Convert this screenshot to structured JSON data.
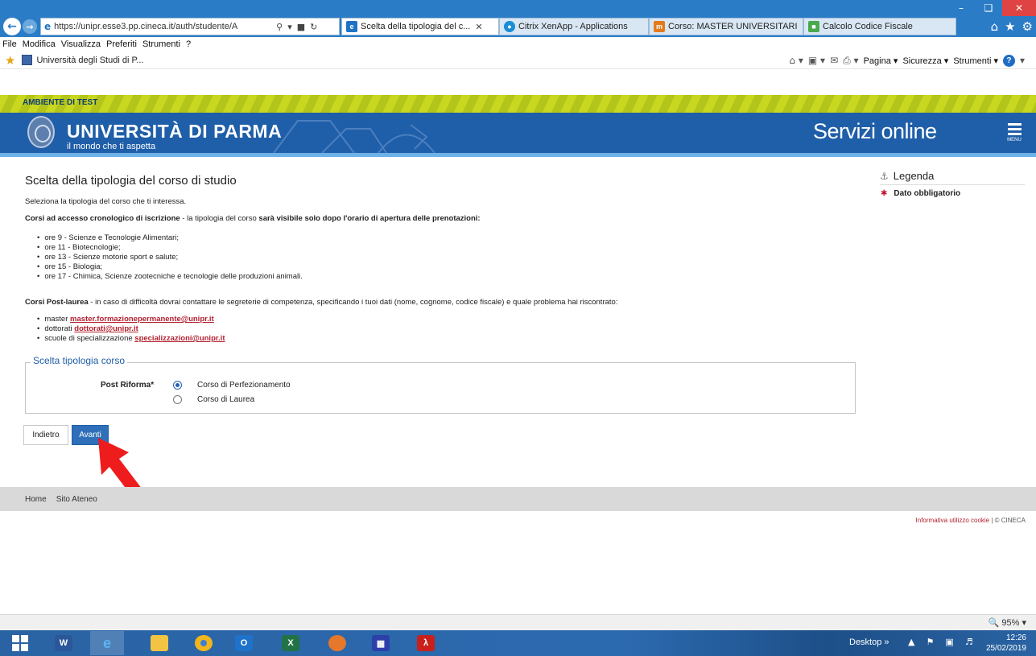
{
  "browser": {
    "address_url": "https://unipr.esse3.pp.cineca.it/auth/studente/A",
    "tabs": [
      {
        "label": "Scelta della tipologia del c...",
        "active": true
      },
      {
        "label": "Citrix XenApp - Applications"
      },
      {
        "label": "Corso: MASTER UNIVERSITARI"
      },
      {
        "label": "Calcolo Codice Fiscale"
      }
    ],
    "menu": [
      "File",
      "Modifica",
      "Visualizza",
      "Preferiti",
      "Strumenti",
      "?"
    ],
    "favorite": "Università degli Studi di P...",
    "commands": {
      "page": "Pagina",
      "security": "Sicurezza",
      "tools": "Strumenti"
    },
    "zoom": "95%",
    "accent": "#2b7cc6"
  },
  "test_banner": "AMBIENTE DI TEST",
  "header": {
    "university": "UNIVERSITÀ DI PARMA",
    "tagline": "il mondo che ti aspetta",
    "services": "Servizi online",
    "menu_label": "MENU",
    "brand_color": "#1f5ea8"
  },
  "main": {
    "title": "Scelta della tipologia del corso di studio",
    "intro": "Seleziona la tipologia del corso che ti interessa.",
    "para1_bold": "Corsi ad accesso cronologico di iscrizione",
    "para1_text": " - la tipologia del corso ",
    "para1_bold2": "sarà visibile solo dopo l'orario di apertura delle prenotazioni:",
    "schedule": [
      "ore 9 - Scienze e Tecnologie Alimentari;",
      "ore 11 - Biotecnologie;",
      "ore 13 - Scienze motorie sport e salute;",
      "ore 15 - Biologia;",
      "ore 17 - Chimica, Scienze zootecniche e tecnologie delle produzioni animali."
    ],
    "para2_bold": "Corsi Post-laurea",
    "para2_text": " - in caso di difficoltà dovrai contattare le segreterie di competenza, specificando i tuoi dati (nome, cognome, codice fiscale) e quale problema hai riscontrato:",
    "contacts": [
      {
        "label": "master ",
        "email": "master.formazionepermanente@unipr.it"
      },
      {
        "label": "dottorati ",
        "email": "dottorati@unipr.it"
      },
      {
        "label": "scuole di specializzazione ",
        "email": "specializzazioni@unipr.it"
      }
    ],
    "fieldset_legend": "Scelta tipologia corso",
    "field_label": "Post Riforma*",
    "options": [
      {
        "label": "Corso di Perfezionamento",
        "selected": true
      },
      {
        "label": "Corso di Laurea",
        "selected": false
      }
    ],
    "back_button": "Indietro",
    "next_button": "Avanti"
  },
  "sidebar": {
    "legend_title": "Legenda",
    "required_label": "Dato obbligatorio"
  },
  "footer": {
    "links": [
      "Home",
      "Sito Ateneo"
    ],
    "cookie_link": "Informativa utilizzo cookie",
    "copyright": " | © CINECA"
  },
  "taskbar": {
    "desktop": "Desktop",
    "time": "12:26",
    "date": "25/02/2019"
  }
}
